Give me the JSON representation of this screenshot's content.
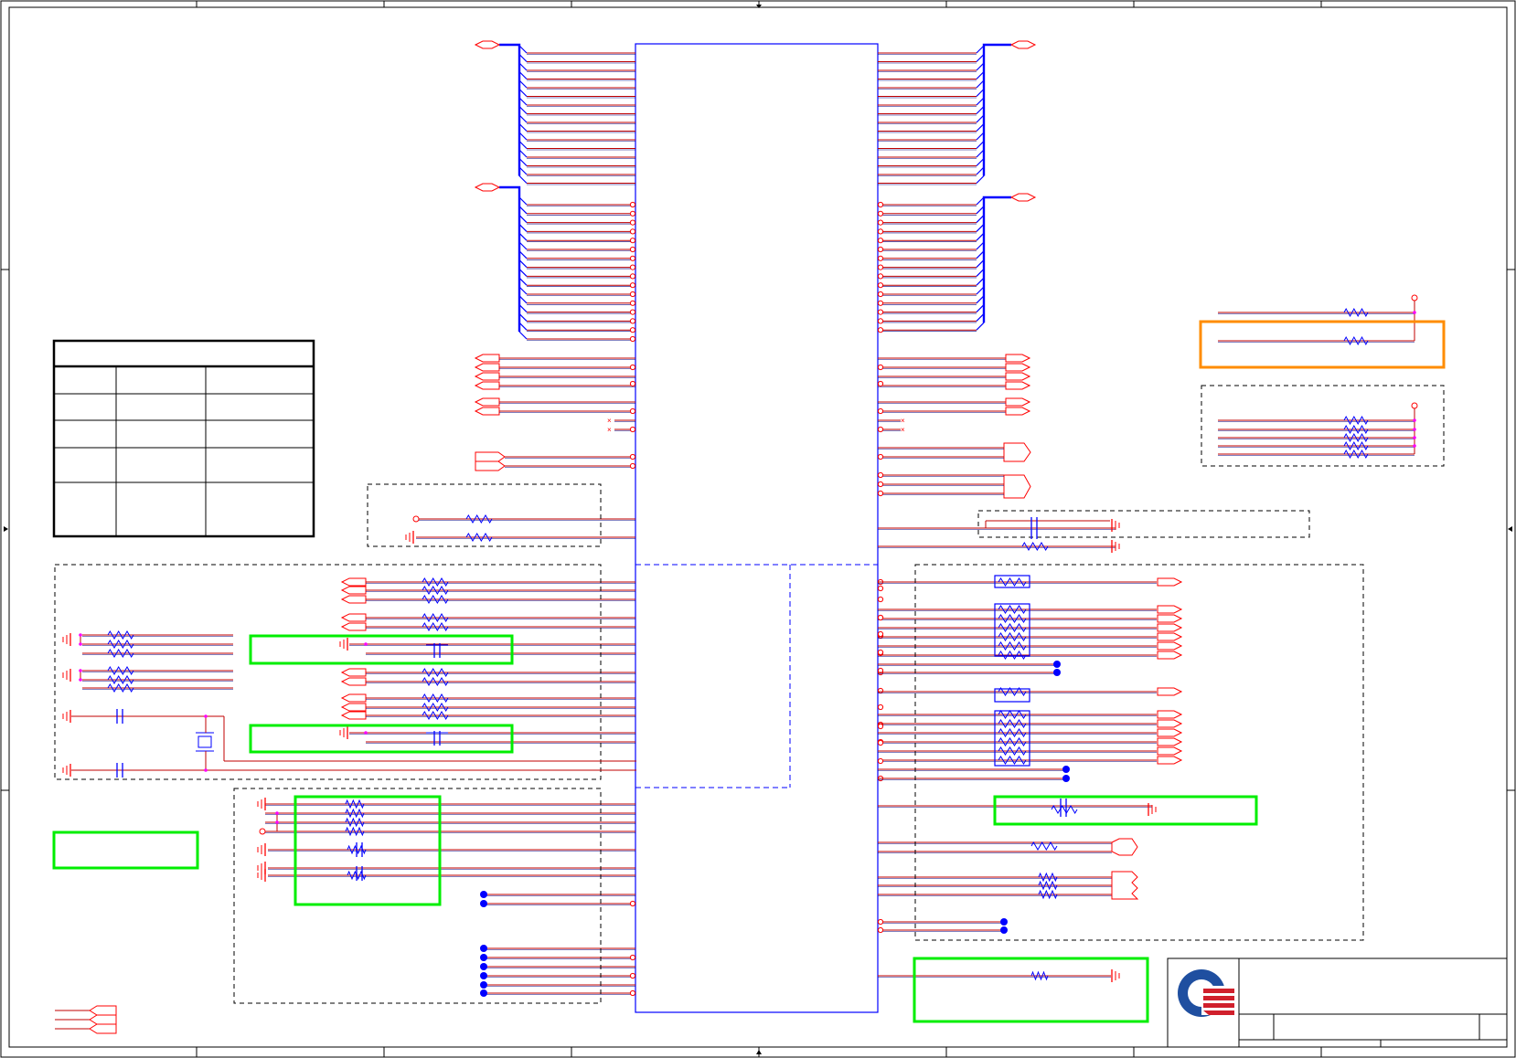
{
  "title_block": {
    "logo": "quanta-logo",
    "fields": []
  },
  "chip": {
    "label": ""
  },
  "table": {
    "title": "",
    "rows": [
      [
        "",
        "",
        ""
      ],
      [
        "",
        "",
        ""
      ],
      [
        "",
        "",
        ""
      ],
      [
        "",
        "",
        ""
      ],
      [
        "",
        "",
        ""
      ]
    ]
  },
  "colors": {
    "frame": "#000000",
    "wire": "#c00000",
    "net": "#000080",
    "bus": "#0000ff",
    "chip": "#0000ff",
    "port": "#ff0000",
    "junction": "#ff00ff",
    "highlight_green": "#00ee00",
    "highlight_orange": "#ff8c00",
    "logo_blue": "#1f4fa0",
    "logo_red": "#d0202c"
  }
}
